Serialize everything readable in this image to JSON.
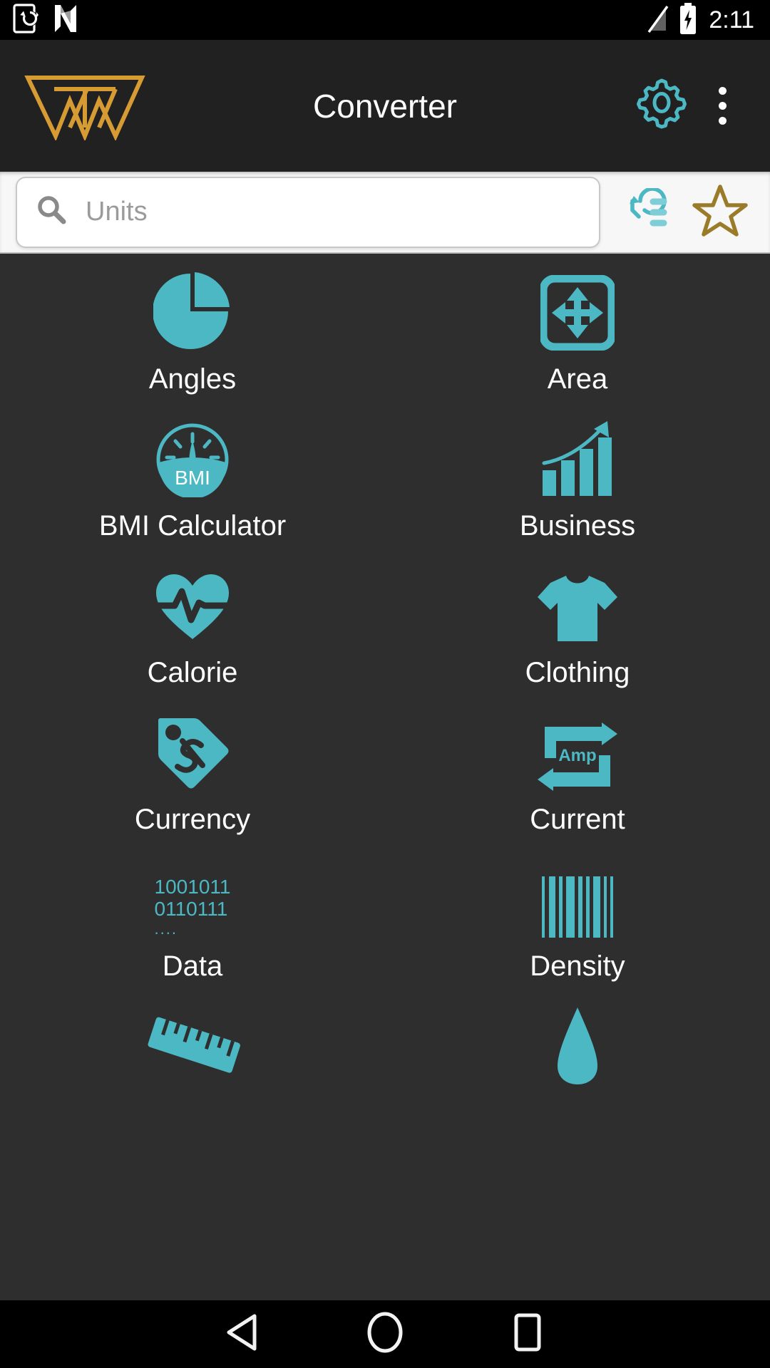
{
  "theme": {
    "accent_teal": "#4cb8c4",
    "gold": "#d79b34",
    "star_gold": "#9a7b2a",
    "appbar_bg": "#212121",
    "grid_bg": "#2e2e2e",
    "search_bg": "#f7f7f7",
    "statusbar_bg": "#000000",
    "label_color": "#ffffff"
  },
  "statusbar": {
    "time": "2:11",
    "left_icons": [
      "sync-disabled-icon",
      "nfc-n-icon"
    ],
    "right_icons": [
      "signal-off-icon",
      "battery-charging-icon"
    ]
  },
  "appbar": {
    "logo_name": "tw-logo",
    "title": "Converter",
    "settings_icon": "gear-icon",
    "overflow_icon": "overflow-menu-icon"
  },
  "search": {
    "icon": "search-icon",
    "value": "",
    "placeholder": "Units",
    "history_icon": "history-icon",
    "favorites_icon": "star-outline-icon"
  },
  "grid": {
    "items": [
      {
        "label": "Angles",
        "icon": "pie-chart-icon"
      },
      {
        "label": "Area",
        "icon": "resize-arrows-icon"
      },
      {
        "label": "BMI Calculator",
        "icon": "bmi-gauge-icon",
        "icon_text": "BMI"
      },
      {
        "label": "Business",
        "icon": "bar-chart-growth-icon"
      },
      {
        "label": "Calorie",
        "icon": "heart-pulse-icon"
      },
      {
        "label": "Clothing",
        "icon": "tshirt-icon"
      },
      {
        "label": "Currency",
        "icon": "price-tag-dollar-icon"
      },
      {
        "label": "Current",
        "icon": "amp-exchange-icon",
        "icon_text": "Amp"
      },
      {
        "label": "Data",
        "icon": "binary-data-icon",
        "binary_line1": "1001011",
        "binary_line2": "0110111",
        "binary_line3": "...."
      },
      {
        "label": "Density",
        "icon": "barcode-icon"
      },
      {
        "label": "",
        "icon": "ruler-icon"
      },
      {
        "label": "",
        "icon": "cone-drop-icon"
      }
    ]
  },
  "navbar": {
    "back_label": "back-button",
    "home_label": "home-button",
    "recents_label": "recents-button"
  }
}
